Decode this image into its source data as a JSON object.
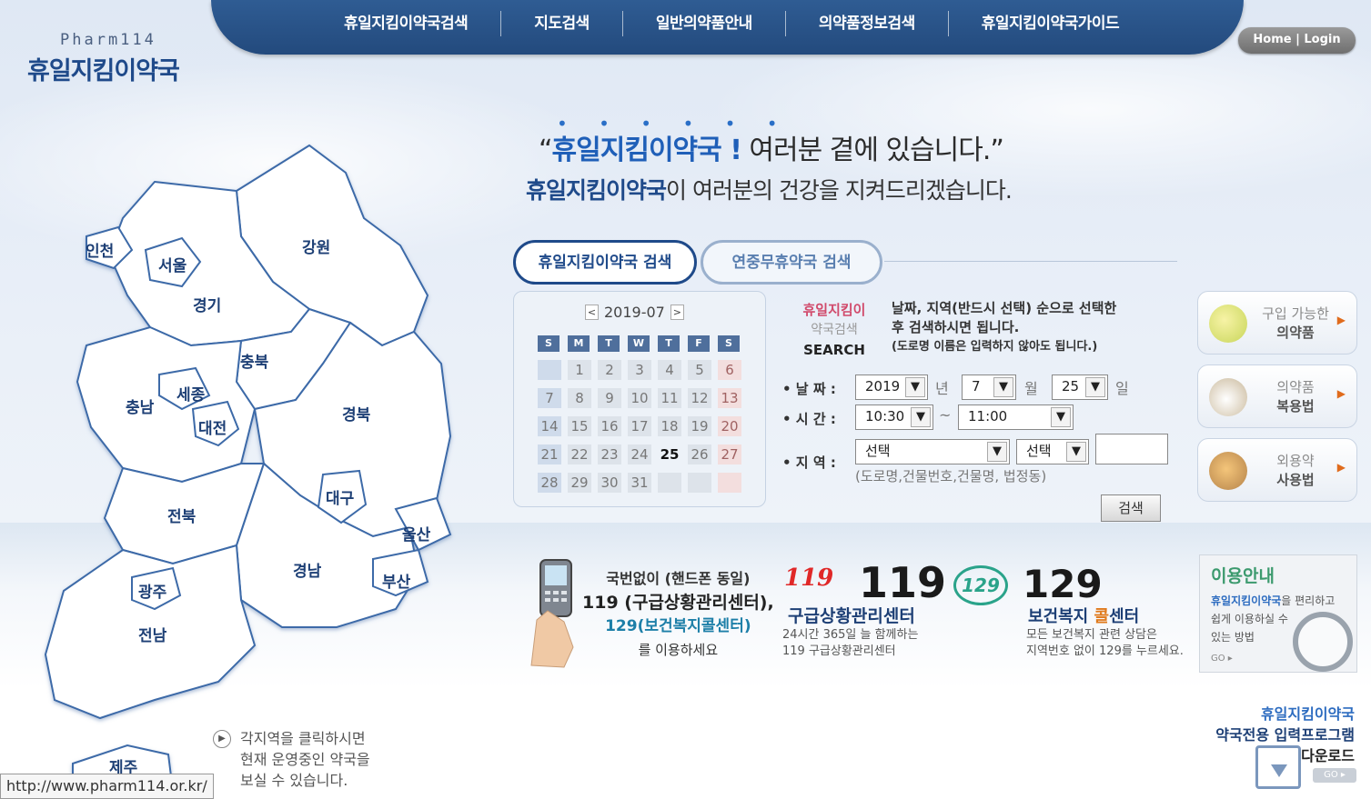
{
  "logo": {
    "sub": "Pharm114",
    "main": "휴일지킴이약국"
  },
  "nav": {
    "items": [
      "휴일지킴이약국검색",
      "지도검색",
      "일반의약품안내",
      "의약품정보검색",
      "휴일지킴이약국가이드"
    ],
    "home_login": "Home | Login"
  },
  "headline": {
    "dots": "• • • • • •",
    "quote_open": "“",
    "brand": "휴일지킴이약국 !",
    "rest": " 여러분 곁에 있습니다.”",
    "sub_brand": "휴일지킴이약국",
    "sub_rest": "이 여러분의 건강을 지켜드리겠습니다."
  },
  "tabs": {
    "active": "휴일지킴이약국 검색",
    "inactive": "연중무휴약국 검색"
  },
  "calendar": {
    "month": "2019-07",
    "prev": "<",
    "next": ">",
    "dow": [
      "S",
      "M",
      "T",
      "W",
      "T",
      "F",
      "S"
    ],
    "days": [
      "",
      "1",
      "2",
      "3",
      "4",
      "5",
      "6",
      "7",
      "8",
      "9",
      "10",
      "11",
      "12",
      "13",
      "14",
      "15",
      "16",
      "17",
      "18",
      "19",
      "20",
      "21",
      "22",
      "23",
      "24",
      "25",
      "26",
      "27",
      "28",
      "29",
      "30",
      "31",
      "",
      "",
      ""
    ],
    "today": "25"
  },
  "search": {
    "title1": "휴일지킴이",
    "title2": "약국검색",
    "title3": "SEARCH",
    "desc1": "날짜, 지역(반드시 선택) 순으로 선택한",
    "desc2": "후 검색하시면 됩니다.",
    "desc3": "(도로명 이름은 입력하지 않아도 됩니다.)",
    "date_label": "• 날 짜 :",
    "time_label": "• 시 간 :",
    "region_label": "• 지 역 :",
    "year": "2019",
    "year_unit": "년",
    "month": "7",
    "month_unit": "월",
    "day": "25",
    "day_unit": "일",
    "time_from": "10:30",
    "time_sep": "~",
    "time_to": "11:00",
    "region1": "선택",
    "region2": "선택",
    "addr_hint": "(도로명,건물번호,건물명, 법정동)",
    "button": "검색"
  },
  "quick": [
    {
      "line1": "구입 가능한",
      "line2": "의약품",
      "icon": "pill-icon"
    },
    {
      "line1": "의약품",
      "line2": "복용법",
      "icon": "mortar-icon"
    },
    {
      "line1": "외용약",
      "line2": "사용법",
      "icon": "ointment-icon"
    }
  ],
  "emergency": {
    "l1": "국번없이 (핸드폰 동일)",
    "l2": "119 (구급상황관리센터),",
    "l3": "129(보건복지콜센터)",
    "l4": "를 이용하세요",
    "logo119": "119",
    "num119": "119",
    "name119": "구급상황관리센터",
    "desc119a": "24시간 365일 늘 함께하는",
    "desc119b": "119 구급상황관리센터",
    "logo129": "129",
    "num129": "129",
    "name129a": "보건복지 ",
    "name129b": "콜",
    "name129c": "센터",
    "desc129a": "모든 보건복지 관련 상담은",
    "desc129b": "지역번호 없이 129를 누르세요."
  },
  "info": {
    "title": "이용안내",
    "brand": "휴일지킴이약국",
    "b1": "을 편리하고",
    "b2": "쉽게 이용하실 수",
    "b3": "있는 방법",
    "go": "GO ▸"
  },
  "download": {
    "l1": "휴일지킴이약국",
    "l2": "약국전용 입력프로그램",
    "l3": "다운로드",
    "go": "GO ▸"
  },
  "map": {
    "regions": [
      "인천",
      "서울",
      "경기",
      "강원",
      "충북",
      "충남",
      "세종",
      "대전",
      "경북",
      "대구",
      "울산",
      "전북",
      "경남",
      "부산",
      "광주",
      "전남",
      "제주"
    ],
    "hint1": "각지역을 클릭하시면",
    "hint2": "현재 운영중인 약국을",
    "hint3": "보실 수 있습니다."
  },
  "status_url": "http://www.pharm114.or.kr/",
  "colors": {
    "nav": "#2f5c93",
    "accent": "#1f4a8a",
    "brand_red": "#d14a6b"
  }
}
